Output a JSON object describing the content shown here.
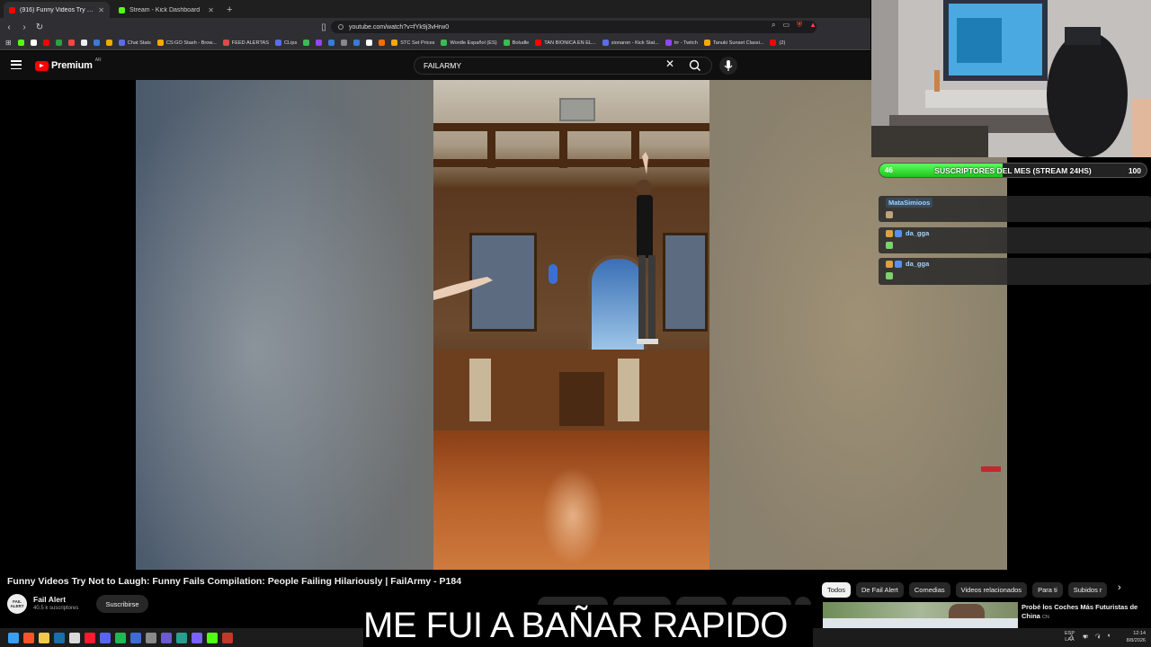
{
  "browser": {
    "tabs": [
      {
        "title": "(916) Funny Videos Try Not to Laugh",
        "active": true,
        "favicon_color": "#ff0000"
      },
      {
        "title": "Stream - Kick Dashboard",
        "active": false,
        "favicon_color": "#53fc18"
      }
    ],
    "new_tab": "+",
    "url": "youtube.com/watch?v=fYk9j3vHrw0",
    "bookmarks": [
      {
        "label": "",
        "color": "#53fc18"
      },
      {
        "label": "",
        "color": "#ffffff"
      },
      {
        "label": "",
        "color": "#ff0000"
      },
      {
        "label": "",
        "color": "#2ea043"
      },
      {
        "label": "",
        "color": "#ff4444"
      },
      {
        "label": "",
        "color": "#eeeeee"
      },
      {
        "label": "",
        "color": "#3a7bd5"
      },
      {
        "label": "",
        "color": "#f2a900"
      },
      {
        "label": "Chat Stats",
        "color": "#5b6ee1"
      },
      {
        "label": "CS:GO Stash - Brow...",
        "color": "#f2a900"
      },
      {
        "label": "FEED ALERTAS",
        "color": "#d94c4c"
      },
      {
        "label": "CLips",
        "color": "#5b6ee1"
      },
      {
        "label": "",
        "color": "#3cba54"
      },
      {
        "label": "",
        "color": "#9146ff"
      },
      {
        "label": "",
        "color": "#3a7bd5"
      },
      {
        "label": "",
        "color": "#888888"
      },
      {
        "label": "",
        "color": "#3a7bd5"
      },
      {
        "label": "",
        "color": "#ffffff"
      },
      {
        "label": "",
        "color": "#ff6a00"
      },
      {
        "label": "STC Set Prices",
        "color": "#f2a900"
      },
      {
        "label": "Wordle Español (ES)",
        "color": "#3cba54"
      },
      {
        "label": "Boludle",
        "color": "#3cba54"
      },
      {
        "label": "TAN BIONICA EN EL...",
        "color": "#ff0000"
      },
      {
        "label": "sionaron - Kick Stat...",
        "color": "#5b6ee1"
      },
      {
        "label": "trr - Twitch",
        "color": "#9146ff"
      },
      {
        "label": "Tanuki Sunset Classi...",
        "color": "#f2a900"
      },
      {
        "label": "(2)",
        "color": "#ff0000"
      }
    ]
  },
  "youtube": {
    "brand": "Premium",
    "country": "AR",
    "search_query": "FAILARMY",
    "video_title": "Funny Videos Try Not to Laugh: Funny Fails Compilation: People Failing Hilariously | FailArmy - P184",
    "channel": {
      "name": "Fail Alert",
      "subscribers": "40.5 k suscriptores",
      "avatar_text": "FAIL ALERT"
    },
    "subscribe_label": "Suscribirse",
    "chips": [
      "Todos",
      "De Fail Alert",
      "Comedias",
      "Videos relacionados",
      "Para ti",
      "Subidos r"
    ],
    "recommended": {
      "title": "Probé los Coches Más Futuristas de China",
      "badge": "CN"
    }
  },
  "overlay": {
    "sub_goal": {
      "current": "46",
      "title": "SUSCRIPTORES DEL MES (STREAM 24HS)",
      "target": "100",
      "progress": 0.46
    },
    "chat": [
      {
        "user": "MataSimioos",
        "user_color": "#9fd3ff"
      },
      {
        "user": "da_gga",
        "user_color": "#9fd3ff"
      },
      {
        "user": "da_gga",
        "user_color": "#9fd3ff"
      }
    ]
  },
  "caption": "ME FUI A BAÑAR RAPIDO",
  "taskbar": {
    "lang": "ESP",
    "layout": "LAA",
    "time": "12:14",
    "date": "8/8/2026",
    "apps": [
      {
        "name": "start",
        "color": "#3a9ff0"
      },
      {
        "name": "brave",
        "color": "#fb542b"
      },
      {
        "name": "explorer",
        "color": "#f2c94c"
      },
      {
        "name": "steam",
        "color": "#1b6fa8"
      },
      {
        "name": "chrome",
        "color": "#d9d9d9"
      },
      {
        "name": "opera",
        "color": "#ff1b2d"
      },
      {
        "name": "discord",
        "color": "#5865f2"
      },
      {
        "name": "spotify",
        "color": "#1db954"
      },
      {
        "name": "app",
        "color": "#3f6ad8"
      },
      {
        "name": "app",
        "color": "#8a8a8a"
      },
      {
        "name": "app",
        "color": "#6a5acd"
      },
      {
        "name": "app",
        "color": "#2a9d8f"
      },
      {
        "name": "app",
        "color": "#7b61ff"
      },
      {
        "name": "kick",
        "color": "#53fc18"
      },
      {
        "name": "app",
        "color": "#c0392b"
      }
    ]
  },
  "colors": {
    "accent_red": "#ff0000",
    "kick_green": "#53fc18"
  }
}
